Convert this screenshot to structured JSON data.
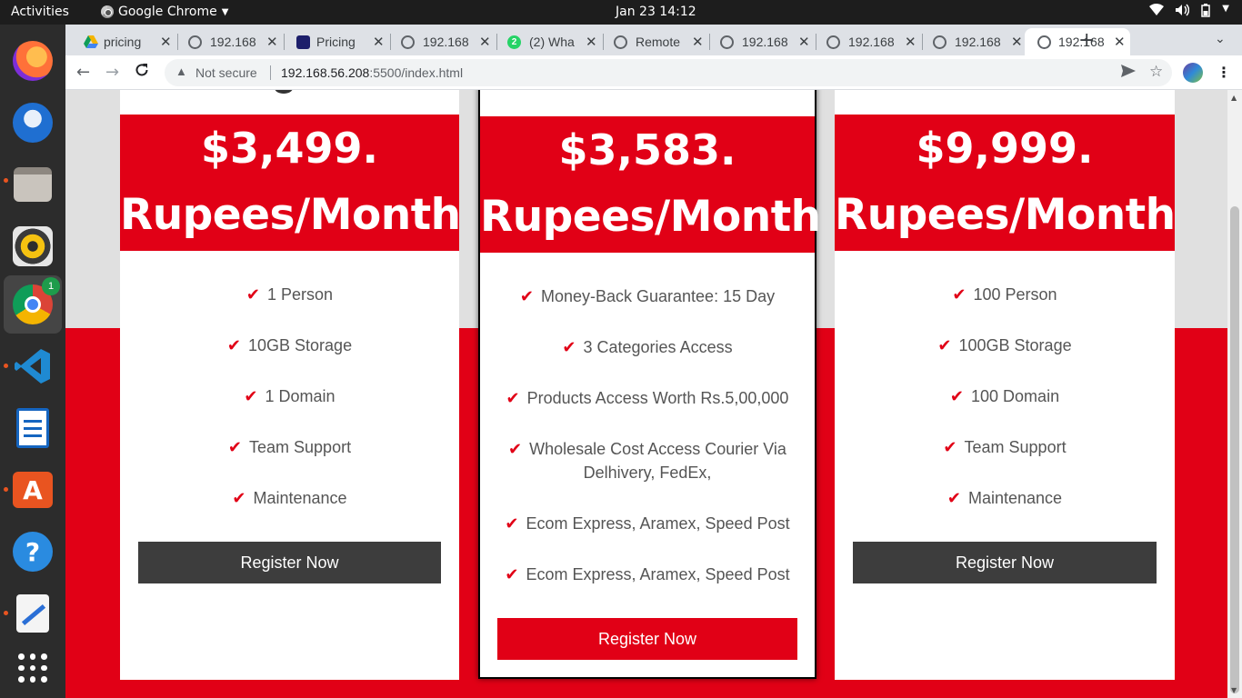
{
  "topbar": {
    "activities": "Activities",
    "app_name": "Google Chrome",
    "clock": "Jan 23  14:12"
  },
  "dock": {
    "chrome_badge": "1"
  },
  "tabs": [
    {
      "title": "pricing",
      "icon": "google-drive-icon"
    },
    {
      "title": "192.168",
      "icon": "globe-icon"
    },
    {
      "title": "Pricing",
      "icon": "site-icon"
    },
    {
      "title": "192.168",
      "icon": "globe-icon"
    },
    {
      "title": "(2) Wha",
      "icon": "whatsapp-icon"
    },
    {
      "title": "Remote",
      "icon": "globe-icon"
    },
    {
      "title": "192.168",
      "icon": "globe-icon"
    },
    {
      "title": "192.168",
      "icon": "globe-icon"
    },
    {
      "title": "192.168",
      "icon": "globe-icon"
    },
    {
      "title": "192.168",
      "icon": "globe-icon"
    }
  ],
  "address_bar": {
    "security": "Not secure",
    "host": "192.168.56.208",
    "path": ":5500/index.html"
  },
  "plans": [
    {
      "price": "$3,499.",
      "period": "Rupees/Month",
      "features": [
        "1 Person",
        "10GB Storage",
        "1 Domain",
        "Team Support",
        "Maintenance"
      ],
      "button": "Register Now"
    },
    {
      "price": "$3,583.",
      "period": "Rupees/Month",
      "features": [
        "Money-Back Guarantee: 15 Day",
        "3 Categories Access",
        "Products Access Worth Rs.5,00,000",
        "Wholesale Cost Access Courier Via",
        "Delhivery, FedEx,",
        "Ecom Express, Aramex, Speed Post",
        "Ecom Express, Aramex, Speed Post"
      ],
      "button": "Register Now"
    },
    {
      "price": "$9,999.",
      "period": "Rupees/Month",
      "features": [
        "100 Person",
        "100GB Storage",
        "100 Domain",
        "Team Support",
        "Maintenance"
      ],
      "button": "Register Now"
    }
  ],
  "colors": {
    "accent": "#e10016",
    "dark_button": "#3d3d3d"
  }
}
